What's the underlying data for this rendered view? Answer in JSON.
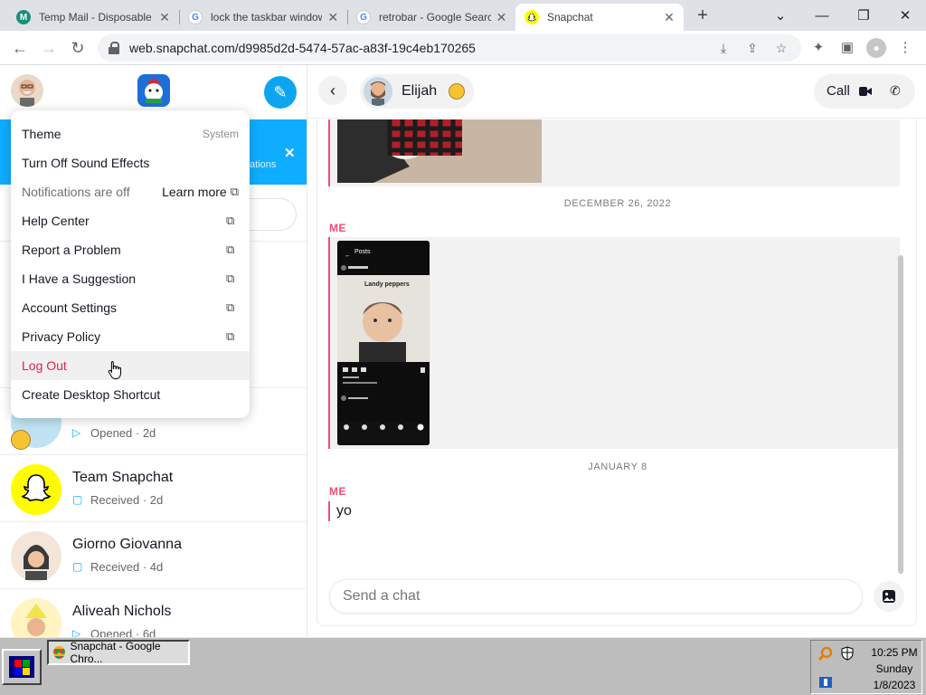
{
  "browser": {
    "tabs": [
      {
        "title": "Temp Mail - Disposable",
        "favicon": "tempmail-icon",
        "active": false
      },
      {
        "title": "lock the taskbar window",
        "favicon": "google-icon",
        "active": false
      },
      {
        "title": "retrobar - Google Search",
        "favicon": "google-icon",
        "active": false
      },
      {
        "title": "Snapchat",
        "favicon": "snapchat-icon",
        "active": true
      }
    ],
    "url": "web.snapchat.com/d9985d2d-5474-57ac-a83f-19c4eb170265"
  },
  "menu": {
    "items": [
      {
        "label": "Theme",
        "value": "System"
      },
      {
        "label": "Turn Off Sound Effects"
      },
      {
        "label": "Notifications are off",
        "link": "Learn more"
      },
      {
        "label": "Help Center"
      },
      {
        "label": "Report a Problem"
      },
      {
        "label": "I Have a Suggestion"
      },
      {
        "label": "Account Settings"
      },
      {
        "label": "Privacy Policy"
      },
      {
        "label": "Log Out"
      },
      {
        "label": "Create Desktop Shortcut"
      }
    ]
  },
  "sidebar": {
    "banner_text": "ations",
    "chats": [
      {
        "name": "",
        "status": "Opened",
        "time": "2d",
        "status_icon": "sent-arrow-icon"
      },
      {
        "name": "Team Snapchat",
        "status": "Received",
        "time": "2d",
        "status_icon": "chat-bubble-icon"
      },
      {
        "name": "Giorno Giovanna",
        "status": "Received",
        "time": "4d",
        "status_icon": "chat-bubble-icon"
      },
      {
        "name": "Aliveah Nichols",
        "status": "Opened",
        "time": "6d",
        "status_icon": "sent-arrow-icon"
      }
    ]
  },
  "conversation": {
    "contact_name": "Elijah",
    "call_label": "Call",
    "messages": [
      {
        "date": "DECEMBER 26, 2022",
        "sender": "ME",
        "type": "image"
      },
      {
        "date": "JANUARY 8",
        "sender": "ME",
        "type": "text",
        "text": "yo"
      }
    ],
    "screenshot_title": "Posts",
    "screenshot_caption": "Landy peppers",
    "input_placeholder": "Send a chat"
  },
  "taskbar": {
    "task_label": "Snapchat - Google Chro...",
    "time": "10:25 PM",
    "day": "Sunday",
    "date": "1/8/2023"
  },
  "colors": {
    "snap_blue": "#0fadff",
    "me_pink": "#f04e77",
    "danger_red": "#e0224e"
  }
}
